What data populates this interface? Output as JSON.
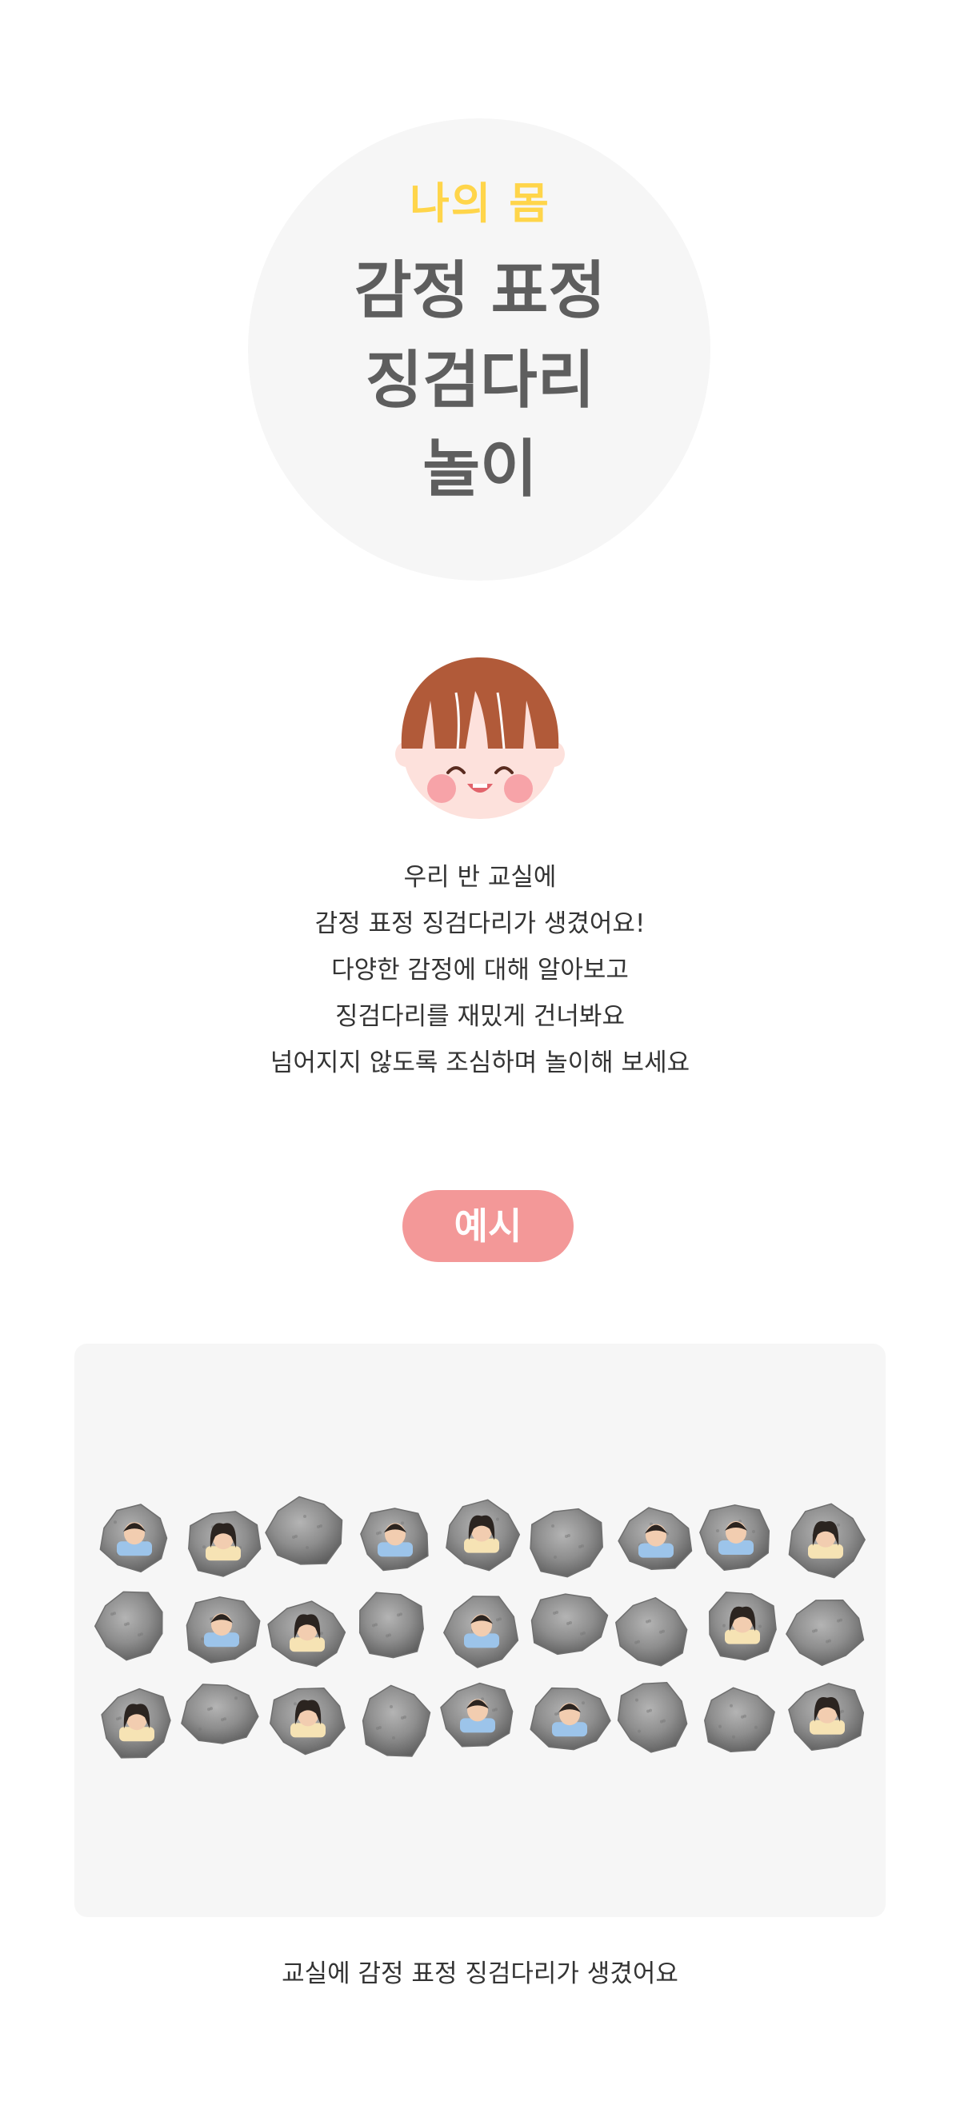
{
  "hero": {
    "subtitle": "나의 몸",
    "title_lines": [
      "감정 표정",
      "징검다리",
      "놀이"
    ]
  },
  "description": {
    "lines": [
      "우리 반 교실에",
      "감정 표정 징검다리가 생겼어요!",
      "다양한 감정에 대해 알아보고",
      "징검다리를 재밌게 건너봐요",
      "넘어지지 않도록 조심하며 놀이해 보세요"
    ]
  },
  "example": {
    "label": "예시"
  },
  "gallery": {
    "caption": "교실에 감정 표정 징검다리가 생겼어요",
    "rows": [
      [
        "boy",
        "girl",
        "plain",
        "boy",
        "girl",
        "plain",
        "boy",
        "boy",
        "girl"
      ],
      [
        "plain",
        "boy",
        "girl",
        "plain",
        "boy",
        "plain",
        "plain",
        "girl",
        "plain"
      ],
      [
        "girl",
        "plain",
        "girl",
        "plain",
        "boy",
        "boy",
        "plain",
        "plain",
        "girl"
      ]
    ]
  },
  "colors": {
    "subtitle": "#ffd54a",
    "title": "#5e5e5e",
    "pill": "#f39898",
    "hair": "#b15a39",
    "cheek": "#f7a3a8",
    "stone": "#8e8e8e"
  },
  "icons": {
    "character": "child-face-icon",
    "stone": "stepping-stone-icon"
  }
}
